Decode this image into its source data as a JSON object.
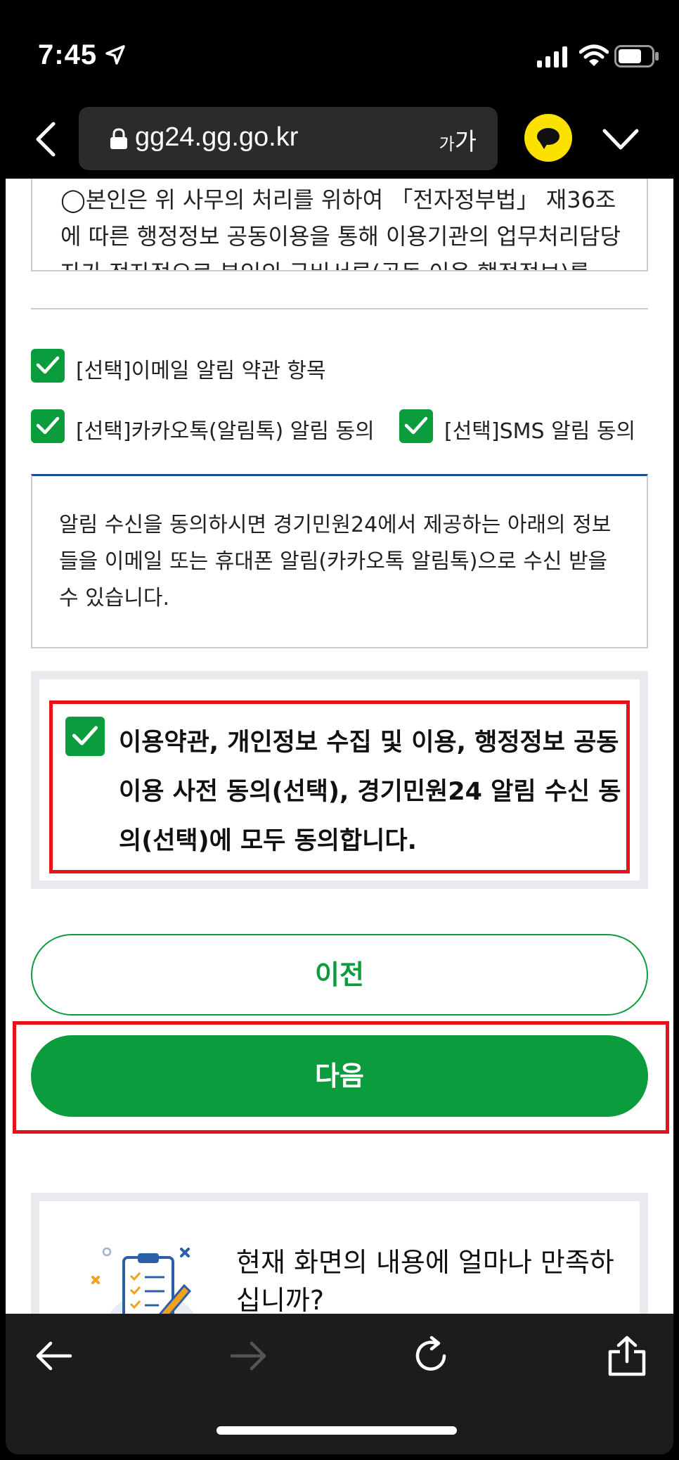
{
  "status": {
    "time": "7:45"
  },
  "browser": {
    "url": "gg24.gg.go.kr",
    "text_size_small": "가",
    "text_size_large": "가"
  },
  "terms_box": {
    "text": "◯본인은 위 사무의 처리를 위하여 「전자정부법」 재36조에 따른 행정정보 공동이용을 통해 이용기관의 업무처리담당자가 전자적으로 본인의 구비서류(공동 이용 행정정보)를"
  },
  "options": {
    "email": "[선택]이메일 알림 약관 항목",
    "kakao": "[선택]카카오톡(알림톡) 알림 동의",
    "sms": "[선택]SMS 알림 동의"
  },
  "notice": {
    "text": "알림 수신을 동의하시면 경기민원24에서 제공하는 아래의 정보들을 이메일 또는 휴대폰 알림(카카오톡 알림톡)으로 수신 받을 수 있습니다."
  },
  "agree_all": {
    "text": "이용약관, 개인정보 수집 및 이용, 행정정보 공동이용 사전 동의(선택), 경기민원24 알림 수신 동의(선택)에 모두 동의합니다."
  },
  "buttons": {
    "prev": "이전",
    "next": "다음"
  },
  "survey": {
    "question": "현재 화면의 내용에 얼마나 만족하십니까?"
  },
  "colors": {
    "accent": "#0b9c3e",
    "highlight": "#e8121c",
    "kakao": "#fae100"
  }
}
